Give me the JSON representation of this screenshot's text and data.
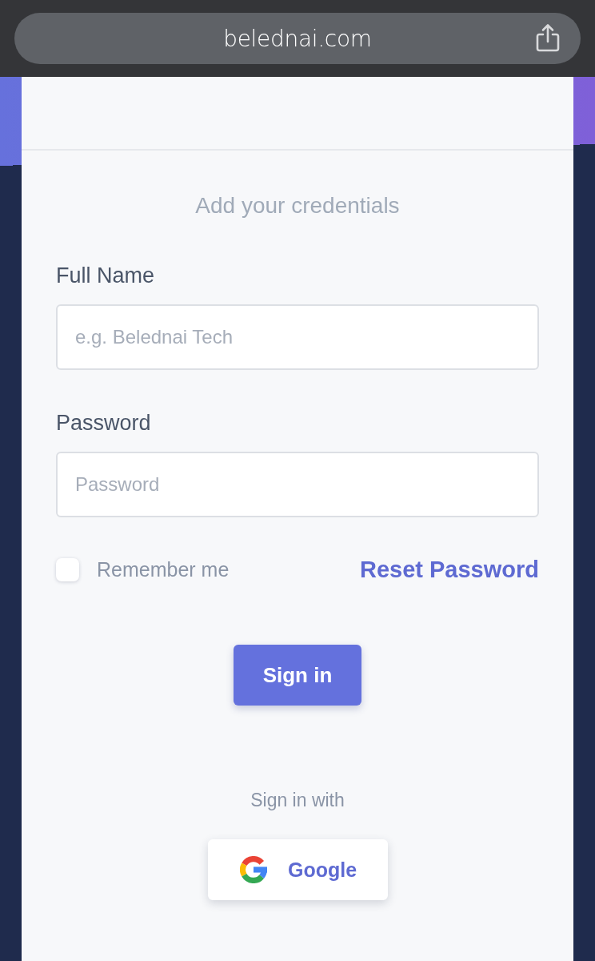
{
  "browser": {
    "url": "belednai.com"
  },
  "form": {
    "heading": "Add your credentials",
    "fields": [
      {
        "label": "Full Name",
        "placeholder": "e.g. Belednai Tech"
      },
      {
        "label": "Password",
        "placeholder": "Password"
      }
    ],
    "remember": {
      "label": "Remember me",
      "checked": false
    },
    "reset_link": "Reset Password",
    "submit": "Sign in"
  },
  "social": {
    "heading": "Sign in with",
    "buttons": [
      {
        "label": "Google",
        "kind": "google"
      }
    ]
  }
}
